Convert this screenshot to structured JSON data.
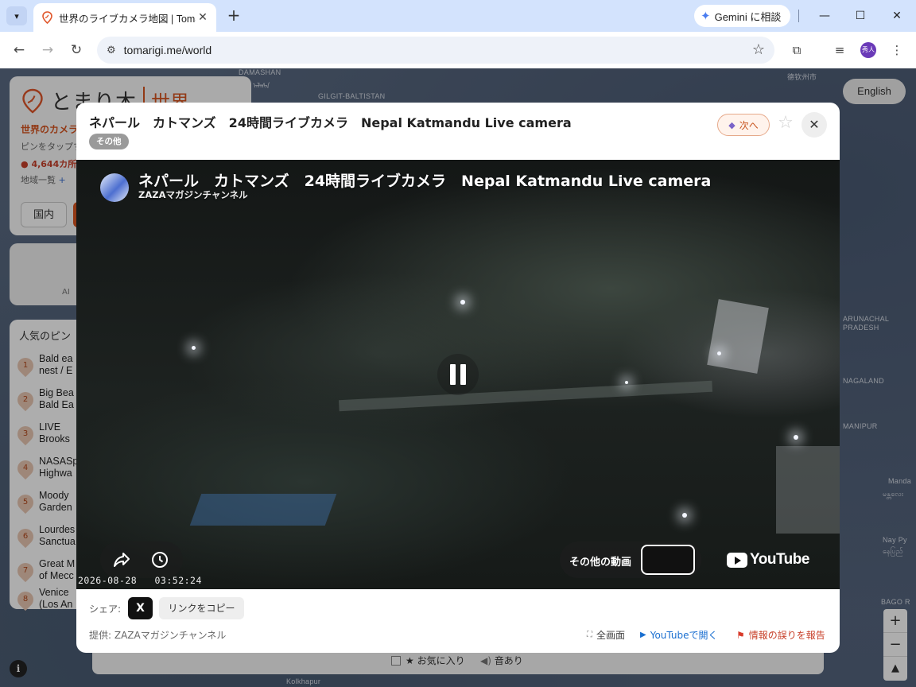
{
  "browser": {
    "tab_title": "世界のライブカメラ地図 | Tomarigi",
    "gemini_label": "Gemini に相談",
    "url": "tomarigi.me/world",
    "avatar_text": "秀人"
  },
  "page": {
    "english_label": "English",
    "logo_text": "とまり木",
    "logo_world": "世界",
    "tagline": "世界のカメラ",
    "subtitle": "ピンをタップす",
    "count": "4,644カ所",
    "region_link": "地域一覧",
    "region_plus": "+",
    "domestic_tab": "国内",
    "ai_text": "AI",
    "popular_heading": "人気のピン",
    "popular": [
      {
        "n": "1",
        "line1": "Bald ea",
        "line2": "nest / E"
      },
      {
        "n": "2",
        "line1": "Big Bea",
        "line2": "Bald Ea"
      },
      {
        "n": "3",
        "line1": "LIVE",
        "line2": "Brooks"
      },
      {
        "n": "4",
        "line1": "NASASp",
        "line2": "Highwa"
      },
      {
        "n": "5",
        "line1": "Moody",
        "line2": "Garden"
      },
      {
        "n": "6",
        "line1": "Lourdes",
        "line2": "Sanctua"
      },
      {
        "n": "7",
        "line1": "Great M",
        "line2": "of Mecc"
      },
      {
        "n": "8",
        "line1": "Venice",
        "line2": "(Los An"
      }
    ],
    "map_labels": {
      "l1": "DAMASHAN",
      "l2": "ᠠᠯᠠᠰᠠ",
      "l3": "GILGIT-BALTISTAN",
      "l4": "德钦州市",
      "l5": "ARUNACHAL",
      "l6": "PRADESH",
      "l7": "NAGALAND",
      "l8": "MANIPUR",
      "l9": "Manda",
      "l10": "မန္တလေး",
      "l11": "Nay Py",
      "l12": "နေပြည်",
      "l13": "BAGO R",
      "l14": "Kolkhapur"
    },
    "bottom_fav": "★ お気に入り",
    "bottom_sound": "音あり",
    "zoom_in": "+",
    "zoom_out": "−"
  },
  "modal": {
    "title": "ネパール　カトマンズ　24時間ライブカメラ　Nepal Katmandu Live camera",
    "category": "その他",
    "next_label": "次へ",
    "share_label": "シェア:",
    "x_label": "X",
    "copy_link": "リンクをコピー",
    "provider": "提供: ZAZAマガジンチャンネル",
    "fullscreen": "全画面",
    "open_youtube": "YouTubeで開く",
    "report": "情報の誤りを報告"
  },
  "video": {
    "title": "ネパール　カトマンズ　24時間ライブカメラ　Nepal Katmandu Live camera",
    "channel": "ZAZAマガジンチャンネル",
    "timestamp": "2026-08-28   03:52:24",
    "more_videos": "その他の動画",
    "youtube_wordmark": "YouTube"
  },
  "colors": {
    "accent_orange": "#d8541f",
    "youtube_link": "#1a6fd0",
    "report_red": "#c8402a"
  }
}
